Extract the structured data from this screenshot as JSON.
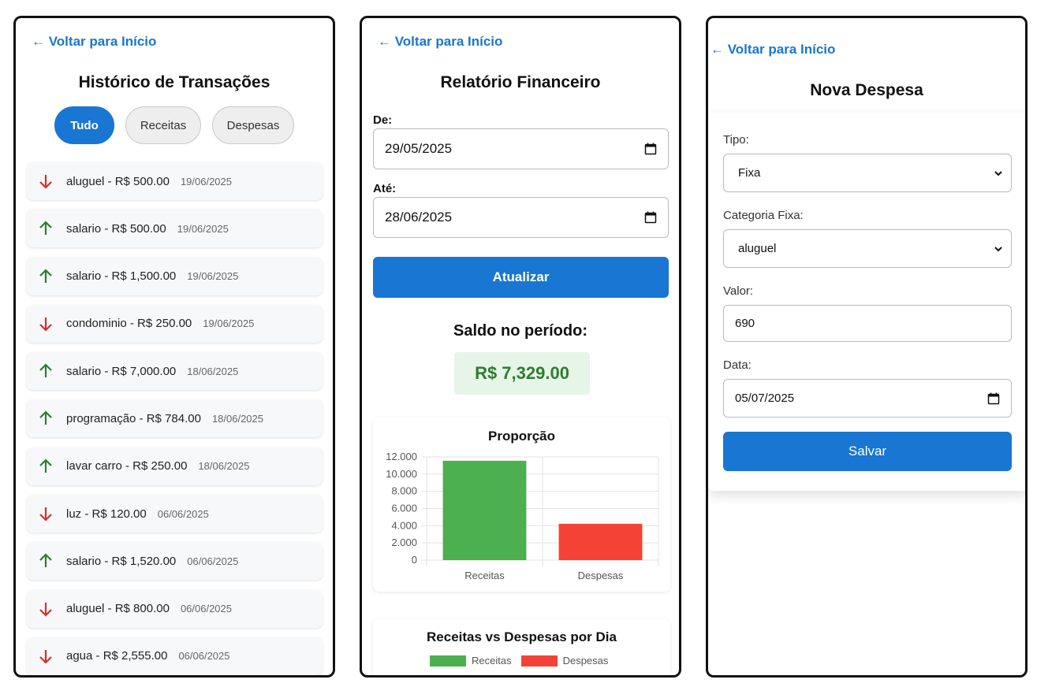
{
  "history": {
    "back_label": "← Voltar para Início",
    "title": "Histórico de Transações",
    "filters": [
      "Tudo",
      "Receitas",
      "Despesas"
    ],
    "active_filter": "Tudo",
    "transactions": [
      {
        "type": "expense",
        "desc": "aluguel - R$ 500.00",
        "date": "19/06/2025"
      },
      {
        "type": "income",
        "desc": "salario - R$ 500.00",
        "date": "19/06/2025"
      },
      {
        "type": "income",
        "desc": "salario - R$ 1,500.00",
        "date": "19/06/2025"
      },
      {
        "type": "expense",
        "desc": "condominio - R$ 250.00",
        "date": "19/06/2025"
      },
      {
        "type": "income",
        "desc": "salario - R$ 7,000.00",
        "date": "18/06/2025"
      },
      {
        "type": "income",
        "desc": "programação - R$ 784.00",
        "date": "18/06/2025"
      },
      {
        "type": "income",
        "desc": "lavar carro - R$ 250.00",
        "date": "18/06/2025"
      },
      {
        "type": "expense",
        "desc": "luz - R$ 120.00",
        "date": "06/06/2025"
      },
      {
        "type": "income",
        "desc": "salario - R$ 1,520.00",
        "date": "06/06/2025"
      },
      {
        "type": "expense",
        "desc": "aluguel - R$ 800.00",
        "date": "06/06/2025"
      },
      {
        "type": "expense",
        "desc": "agua - R$ 2,555.00",
        "date": "06/06/2025"
      }
    ],
    "icons": {
      "income": "arrow-up-icon",
      "expense": "arrow-down-icon"
    },
    "colors": {
      "income": "#2e7d32",
      "expense": "#d32f2f",
      "accent": "#1976d2"
    }
  },
  "report": {
    "back_label": "← Voltar para Início",
    "title": "Relatório Financeiro",
    "from_label": "De:",
    "from_value": "29/05/2025",
    "to_label": "Até:",
    "to_value": "28/06/2025",
    "update_button": "Atualizar",
    "saldo_label": "Saldo no período:",
    "saldo_value": "R$ 7,329.00",
    "daily_chart_title": "Receitas vs Despesas por Dia"
  },
  "chart_data": [
    {
      "type": "bar",
      "title": "Proporção",
      "categories": [
        "Receitas",
        "Despesas"
      ],
      "values": [
        11554,
        4225
      ],
      "colors": [
        "#4caf50",
        "#f44336"
      ],
      "ylim": [
        0,
        12000
      ],
      "yticks": [
        "0",
        "2.000",
        "4.000",
        "6.000",
        "8.000",
        "10.000",
        "12.000"
      ],
      "grid": true
    },
    {
      "type": "bar",
      "title": "Receitas vs Despesas por Dia",
      "series": [
        {
          "name": "Receitas",
          "color": "#4caf50"
        },
        {
          "name": "Despesas",
          "color": "#f44336"
        }
      ],
      "legend": "top"
    }
  ],
  "new_expense": {
    "back_label": "← Voltar para Início",
    "title": "Nova Despesa",
    "tipo_label": "Tipo:",
    "tipo_value": "Fixa",
    "categoria_label": "Categoria Fixa:",
    "categoria_value": "aluguel",
    "valor_label": "Valor:",
    "valor_value": "690",
    "data_label": "Data:",
    "data_value": "05/07/2025",
    "save_button": "Salvar"
  }
}
